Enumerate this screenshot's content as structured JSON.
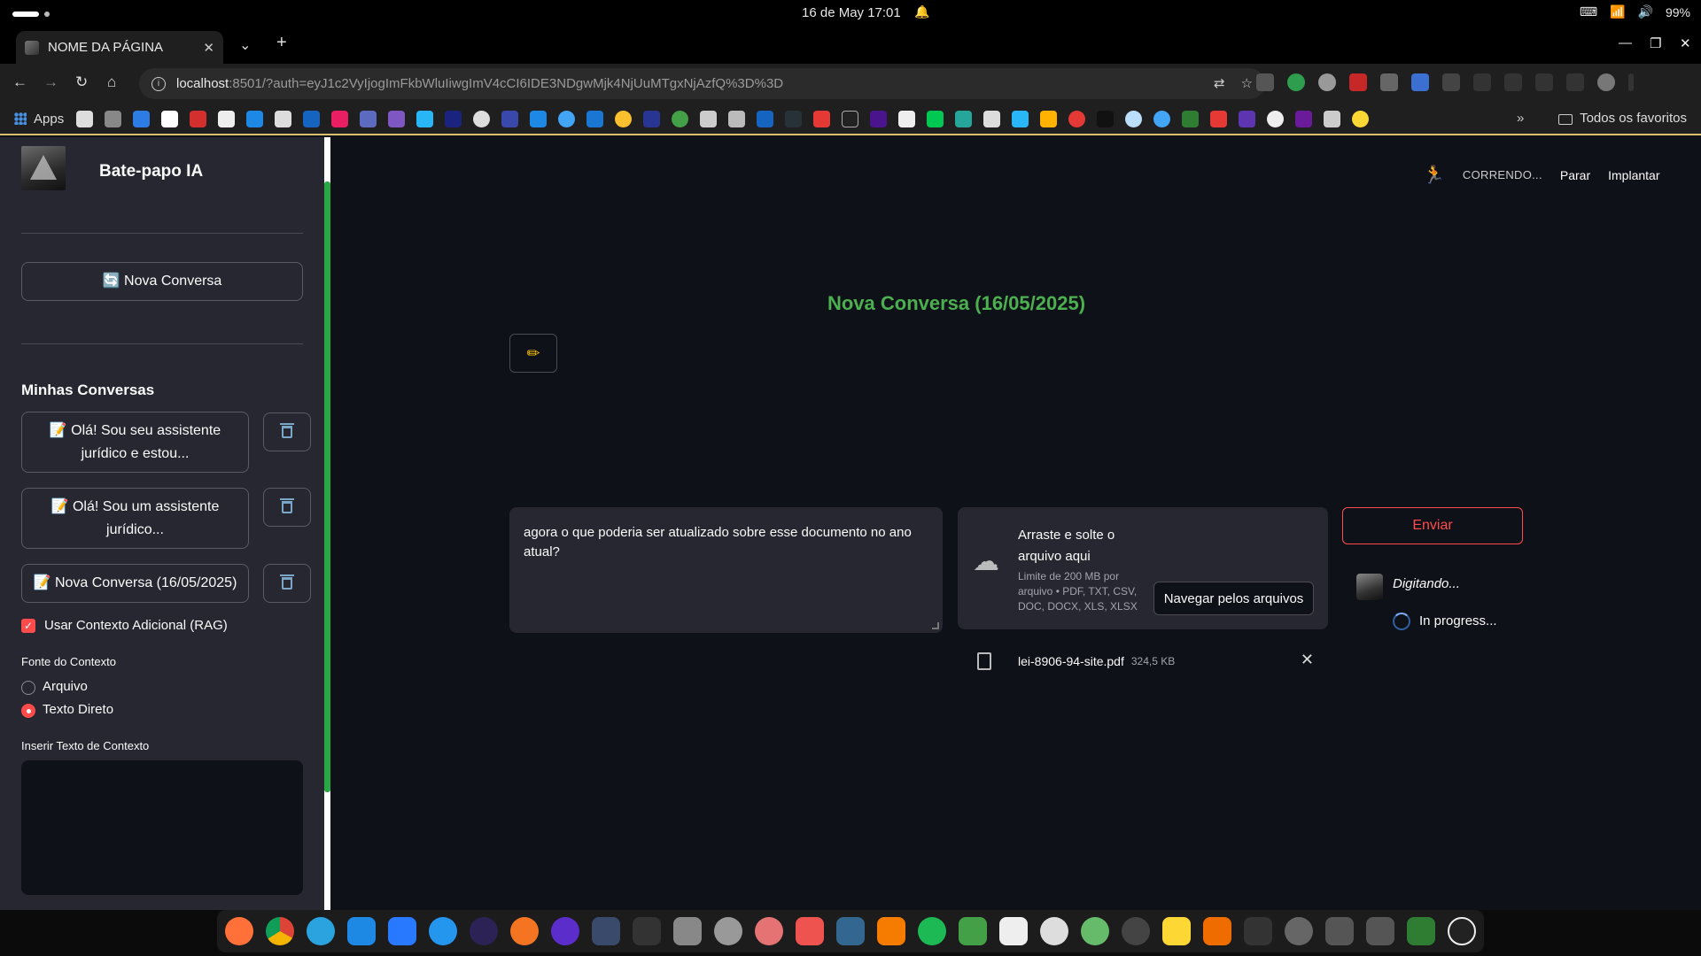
{
  "os": {
    "clock": "16 de May  17:01",
    "battery": "99%"
  },
  "browser": {
    "tab_title": "NOME DA PÁGINA",
    "url_host": "localhost",
    "url_rest": ":8501/?auth=eyJ1c2VyIjogImFkbWluIiwgImV4cCI6IDE3NDgwMjk4NjUuMTgxNjAzfQ%3D%3D",
    "bookmarks_apps": "Apps",
    "bookmarks_all": "Todos os favoritos"
  },
  "sidebar": {
    "app_name": "Bate-papo IA",
    "new_chat": "🔄 Nova Conversa",
    "my_chats_title": "Minhas Conversas",
    "chats": [
      {
        "label": "📝 Olá! Sou seu assistente jurídico e estou..."
      },
      {
        "label": "📝 Olá! Sou um assistente jurídico..."
      },
      {
        "label": "📝 Nova Conversa (16/05/2025)"
      }
    ],
    "rag_label": "Usar Contexto Adicional (RAG)",
    "rag_checked": true,
    "source_label": "Fonte do Contexto",
    "source_options": [
      "Arquivo",
      "Texto Direto"
    ],
    "source_selected": "Texto Direto",
    "context_label": "Inserir Texto de Contexto",
    "context_value": ""
  },
  "header": {
    "status": "CORRENDO...",
    "stop": "Parar",
    "deploy": "Implantar"
  },
  "main": {
    "title": "Nova Conversa (16/05/2025)",
    "edit_icon": "pencil-icon",
    "message": "agora o que poderia ser atualizado sobre esse documento no ano atual?",
    "upload": {
      "title": "Arraste e solte o arquivo aqui",
      "limit": "Limite de 200 MB por arquivo • PDF, TXT, CSV, DOC, DOCX, XLS, XLSX",
      "browse": "Navegar pelos arquivos"
    },
    "file": {
      "name": "lei-8906-94-site.pdf",
      "size": "324,5 KB"
    },
    "send": "Enviar",
    "typing": "Digitando...",
    "progress": "In progress..."
  },
  "colors": {
    "accent": "#ff4b4b",
    "title_green": "#4caf50",
    "sidebar_bg": "#262730",
    "main_bg": "#0e1117"
  }
}
